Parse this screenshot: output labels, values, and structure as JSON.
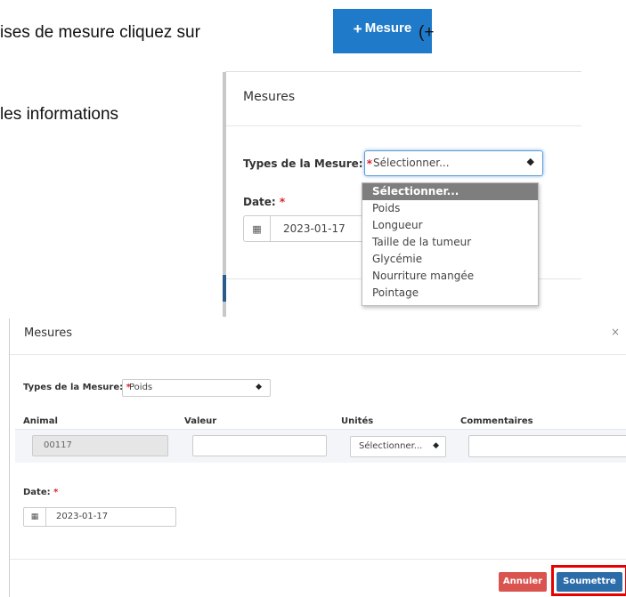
{
  "doc": {
    "line1_start": "ises de mesure cliquez sur",
    "line1_end": "(+",
    "line2": "les informations"
  },
  "mesure_button": {
    "plus": "+",
    "label": "Mesure"
  },
  "top_modal": {
    "title": "Mesures",
    "type_label": "Types de la Mesure:",
    "required_mark": "*",
    "select_value": "Sélectionner...",
    "date_label": "Date:",
    "date_value": "2023-01-17",
    "dropdown_options": [
      "Sélectionner...",
      "Poids",
      "Longueur",
      "Taille de la tumeur",
      "Glycémie",
      "Nourriture mangée",
      "Pointage"
    ]
  },
  "bottom_modal": {
    "title": "Mesures",
    "close": "×",
    "type_label": "Types de la Mesure:",
    "required_mark": "*",
    "select_value": "Poids",
    "columns": {
      "animal": "Animal",
      "valeur": "Valeur",
      "unites": "Unités",
      "commentaires": "Commentaires"
    },
    "row": {
      "animal": "00117",
      "valeur": "",
      "unites": "Sélectionner...",
      "commentaires": ""
    },
    "date_label": "Date:",
    "date_value": "2023-01-17",
    "cancel_label": "Annuler",
    "submit_label": "Soumettre"
  },
  "colors": {
    "primary": "#2c6ca8",
    "danger": "#d9534f",
    "highlight": "#e60000",
    "dropdown_selected": "#7e7e7e"
  },
  "icons": {
    "calendar": "calendar-icon",
    "caret": "select-caret-icon",
    "close": "close-icon"
  }
}
